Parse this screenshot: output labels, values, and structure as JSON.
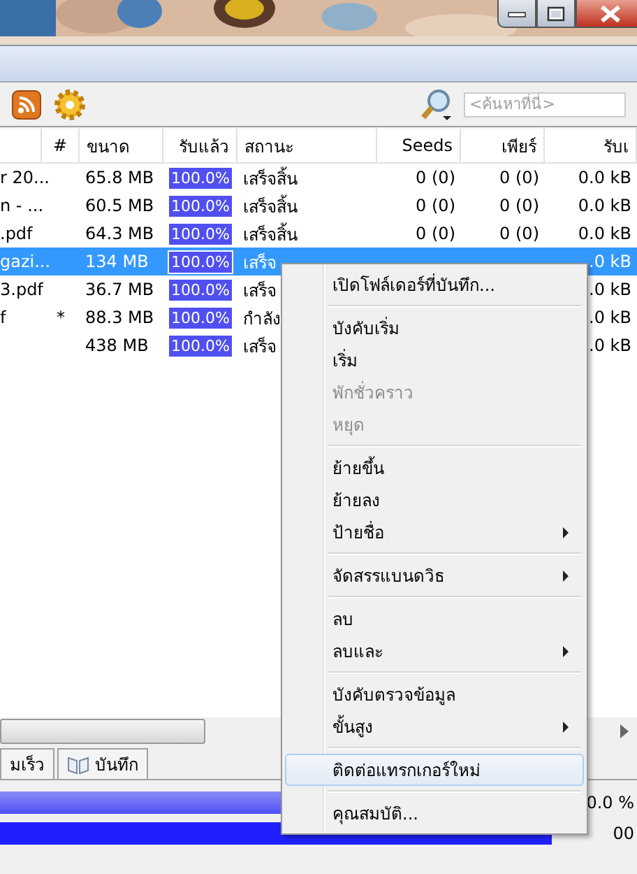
{
  "search": {
    "placeholder": "<ค้นหาที่นี่>"
  },
  "table": {
    "columns": [
      "",
      "#",
      "ขนาด",
      "รับแล้ว",
      "สถานะ",
      "Seeds",
      "เพียร์",
      "รับเ"
    ],
    "rows": [
      {
        "name": "r 20...",
        "mark": "",
        "size": "65.8 MB",
        "level": 1,
        "done": "100.0%",
        "status": "เสร็จสิ้น",
        "seeds": "0 (0)",
        "peers": "0 (0)",
        "down": "0.0 kB",
        "selected": false
      },
      {
        "name": "n - ...",
        "mark": "",
        "size": "60.5 MB",
        "level": 1,
        "done": "100.0%",
        "status": "เสร็จสิ้น",
        "seeds": "0 (0)",
        "peers": "0 (0)",
        "down": "0.0 kB",
        "selected": false
      },
      {
        "name": ".pdf",
        "mark": "",
        "size": "64.3 MB",
        "level": 1,
        "done": "100.0%",
        "status": "เสร็จสิ้น",
        "seeds": "0 (0)",
        "peers": "0 (0)",
        "down": "0.0 kB",
        "selected": false
      },
      {
        "name": "gazi...",
        "mark": "",
        "size": "134 MB",
        "level": 1,
        "done": "100.0%",
        "status": "เสร็จ",
        "seeds": "",
        "peers": "",
        "down": ".0 kB",
        "selected": true
      },
      {
        "name": "3.pdf",
        "mark": "",
        "size": "36.7 MB",
        "level": 1,
        "done": "100.0%",
        "status": "เสร็จ",
        "seeds": "",
        "peers": "",
        "down": ".0 kB",
        "selected": false
      },
      {
        "name": "f",
        "mark": "*",
        "size": "88.3 MB",
        "level": 1,
        "done": "100.0%",
        "status": "กำลัง",
        "seeds": "",
        "peers": "",
        "down": ".0 kB",
        "selected": false
      },
      {
        "name": "",
        "mark": "",
        "size": "438 MB",
        "level": 1,
        "done": "100.0%",
        "status": "เสร็จ",
        "seeds": "",
        "peers": "",
        "down": ".0 kB",
        "selected": false
      }
    ]
  },
  "bottom_tabs": [
    {
      "label": "มเร็ว"
    },
    {
      "label": "บันทึก"
    }
  ],
  "bottom_bars": [
    {
      "reading": "0.0 %"
    },
    {
      "reading": "00"
    }
  ],
  "context_menu": {
    "groups": [
      [
        {
          "label": "เปิดโฟล์เดอร์ที่บันทึก...",
          "disabled": false,
          "submenu": false,
          "highlighted": false
        }
      ],
      [
        {
          "label": "บังคับเริ่ม",
          "disabled": false,
          "submenu": false,
          "highlighted": false
        },
        {
          "label": "เริ่ม",
          "disabled": false,
          "submenu": false,
          "highlighted": false
        },
        {
          "label": "พักชั่วคราว",
          "disabled": true,
          "submenu": false,
          "highlighted": false
        },
        {
          "label": "หยุด",
          "disabled": true,
          "submenu": false,
          "highlighted": false
        }
      ],
      [
        {
          "label": "ย้ายขึ้น",
          "disabled": false,
          "submenu": false,
          "highlighted": false
        },
        {
          "label": "ย้ายลง",
          "disabled": false,
          "submenu": false,
          "highlighted": false
        },
        {
          "label": "ป้ายชื่อ",
          "disabled": false,
          "submenu": true,
          "highlighted": false
        }
      ],
      [
        {
          "label": "จัดสรรแบนดวิธ",
          "disabled": false,
          "submenu": true,
          "highlighted": false
        }
      ],
      [
        {
          "label": "ลบ",
          "disabled": false,
          "submenu": false,
          "highlighted": false
        },
        {
          "label": "ลบและ",
          "disabled": false,
          "submenu": true,
          "highlighted": false
        }
      ],
      [
        {
          "label": "บังคับตรวจข้อมูล",
          "disabled": false,
          "submenu": false,
          "highlighted": false
        },
        {
          "label": "ขั้นสูง",
          "disabled": false,
          "submenu": true,
          "highlighted": false
        }
      ],
      [
        {
          "label": "ติดต่อแทรกเกอร์ใหม่",
          "disabled": false,
          "submenu": false,
          "highlighted": true
        }
      ],
      [
        {
          "label": "คุณสมบัติ...",
          "disabled": false,
          "submenu": false,
          "highlighted": false
        }
      ]
    ]
  }
}
